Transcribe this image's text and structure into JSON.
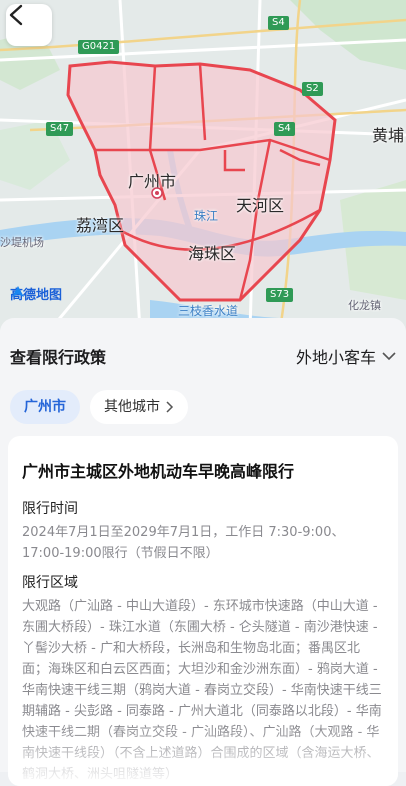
{
  "map": {
    "labels": {
      "guangzhou": "广州市",
      "tianhe": "天河区",
      "liwan": "荔湾区",
      "haizhu": "海珠区",
      "huangpu": "黄埔",
      "zhujiang": "珠江",
      "airport": "沙堤机场",
      "hualongzhen": "化龙镇",
      "sanzhi": "三枝香水道"
    },
    "shields": {
      "g0421": "G0421",
      "s4_top": "S4",
      "s47": "S47",
      "s4_mid": "S4",
      "s2": "S2",
      "s73": "S73"
    },
    "logo_text": "高德地图",
    "colors": {
      "restriction_line": "#e8464f",
      "restriction_fill": "#f7c9cf",
      "water": "#8fc6ef"
    }
  },
  "policy": {
    "section_title": "查看限行政策",
    "vehicle_type": "外地小客车",
    "tabs": {
      "active": "广州市",
      "other": "其他城市"
    }
  },
  "rule": {
    "title": "广州市主城区外地机动车早晚高峰限行",
    "time_label": "限行时间",
    "time_text": "2024年7月1日至2029年7月1日，工作日 7:30-9:00、17:00-19:00限行（节假日不限）",
    "area_label": "限行区域",
    "area_text": "大观路（广汕路 - 中山大道段）- 东环城市快速路（中山大道 - 东圃大桥段）- 珠江水道（东圃大桥 - 仑头隧道 - 南沙港快速 - 丫髻沙大桥 - 广和大桥段，长洲岛和生物岛北面；番禺区北面；海珠区和白云区西面；大坦沙和金沙洲东面）- 鸦岗大道 - 华南快速干线三期（鸦岗大道 - 春岗立交段）- 华南快速干线三期辅路 - 尖彭路 - 同泰路 - 广州大道北（同泰路以北段）- 华南快速干线二期（春岗立交段 - 广汕路段）、广汕路（大观路 - 华南快速干线段）（不含上述道路）合围成的区域（含海运大桥、鹤洞大桥、洲头咀隧道等）"
  }
}
